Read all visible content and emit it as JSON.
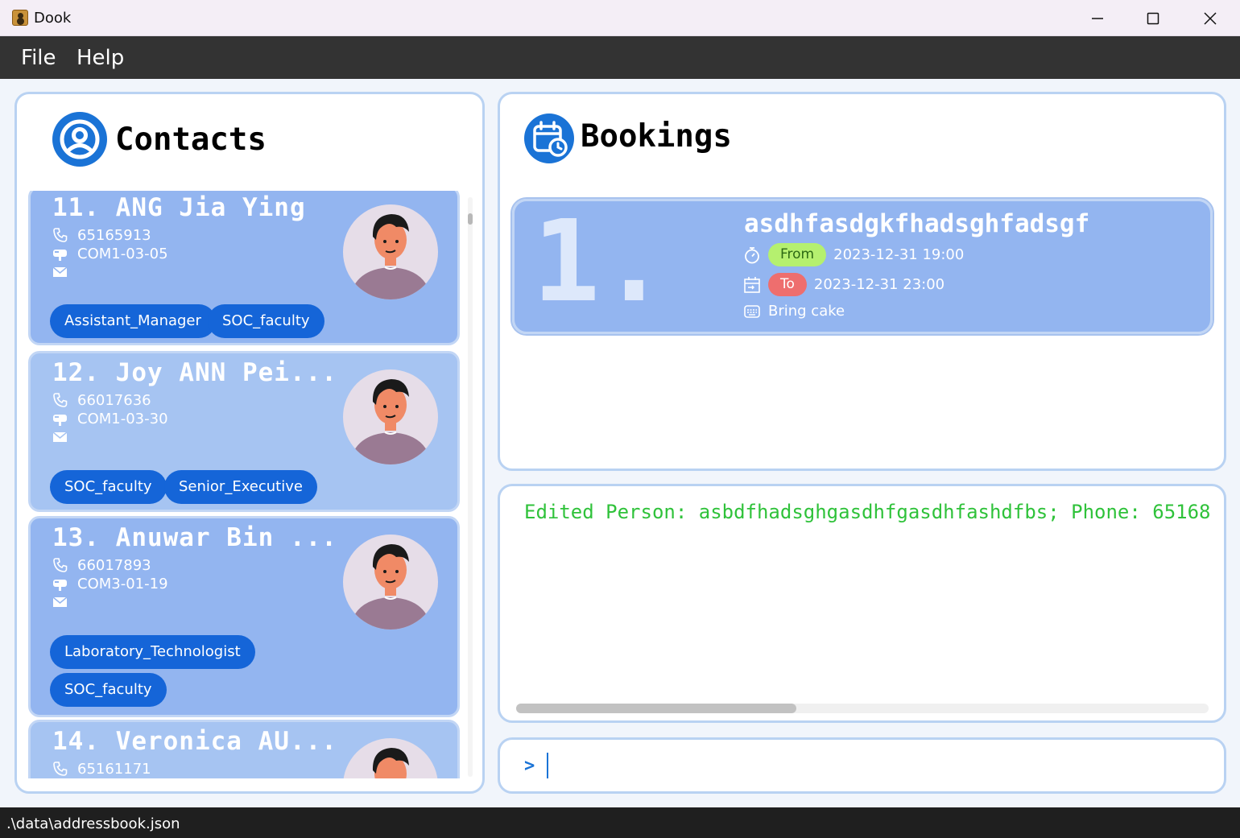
{
  "window": {
    "title": "Dook"
  },
  "menu": {
    "file": "File",
    "help": "Help"
  },
  "contacts": {
    "title": "Contacts",
    "items": [
      {
        "name": "11.  ANG Jia Ying",
        "phone": "65165913",
        "address": "COM1-03-05",
        "email": "",
        "tags": [
          "Assistant_Manager",
          "SOC_faculty"
        ]
      },
      {
        "name": "12.  Joy ANN Pei...",
        "phone": "66017636",
        "address": "COM1-03-30",
        "email": "",
        "tags": [
          "SOC_faculty",
          "Senior_Executive"
        ]
      },
      {
        "name": "13.  Anuwar Bin ...",
        "phone": "66017893",
        "address": "COM3-01-19",
        "email": "",
        "tags": [
          "Laboratory_Technologist",
          "SOC_faculty"
        ]
      },
      {
        "name": "14.  Veronica AU...",
        "phone": "65161171",
        "address": "",
        "email": "",
        "tags": []
      }
    ]
  },
  "bookings": {
    "title": "Bookings",
    "items": [
      {
        "index": "1.",
        "title": "asdhfasdgkfhadsghfadsgf",
        "from_label": "From",
        "from": "2023-12-31 19:00",
        "to_label": "To",
        "to": "2023-12-31 23:00",
        "note": "Bring cake"
      }
    ]
  },
  "result": {
    "text": "Edited Person: asbdfhadsghgasdhfgasdhfashdfbs; Phone: 65168"
  },
  "command": {
    "prompt": ">",
    "value": ""
  },
  "status": {
    "path": ".\\data\\addressbook.json"
  },
  "colors": {
    "accent": "#1a73d6",
    "card": "#93b5f0",
    "tag": "#1565d8",
    "from_pill": "#b5f06f",
    "to_pill": "#ee6e6e",
    "result_text": "#2fc23a"
  }
}
